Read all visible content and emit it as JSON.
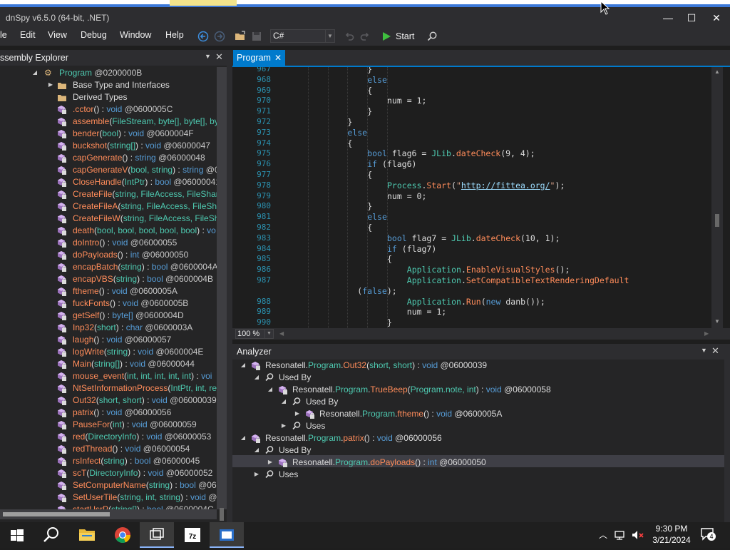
{
  "window": {
    "title": "dnSpy v6.5.0 (64-bit, .NET)",
    "minimize": "—",
    "maximize": "☐",
    "close": "✕"
  },
  "menu": [
    "le",
    "Edit",
    "View",
    "Debug",
    "Window",
    "Help"
  ],
  "toolbar": {
    "language": "C#",
    "start_label": "Start"
  },
  "assembly_explorer": {
    "title": "ssembly Explorer",
    "root": {
      "name": "Program",
      "token": "@0200000B"
    },
    "folders": [
      "Base Type and Interfaces",
      "Derived Types"
    ],
    "methods": [
      {
        "name": ".cctor",
        "args": "",
        "ret": "void",
        "token": "@0600005C"
      },
      {
        "name": "assemble",
        "args": "FileStream, byte[], byte[], by",
        "ret": "",
        "token": ""
      },
      {
        "name": "bender",
        "args": "bool",
        "ret": "void",
        "token": "@0600004F"
      },
      {
        "name": "buckshot",
        "args": "string[]",
        "ret": "void",
        "token": "@06000047"
      },
      {
        "name": "capGenerate",
        "args": "",
        "ret": "string",
        "token": "@06000048"
      },
      {
        "name": "capGenerateV",
        "args": "bool, string",
        "ret": "string",
        "token": "@0"
      },
      {
        "name": "CloseHandle",
        "args": "IntPtr",
        "ret": "bool",
        "token": "@06000041"
      },
      {
        "name": "CreateFile",
        "args": "string, FileAccess, FileShare,",
        "ret": "",
        "token": ""
      },
      {
        "name": "CreateFileA",
        "args": "string, FileAccess, FileShar",
        "ret": "",
        "token": ""
      },
      {
        "name": "CreateFileW",
        "args": "string, FileAccess, FileSha",
        "ret": "",
        "token": ""
      },
      {
        "name": "death",
        "args": "bool, bool, bool, bool, bool",
        "ret": "vo",
        "token": ""
      },
      {
        "name": "doIntro",
        "args": "",
        "ret": "void",
        "token": "@06000055"
      },
      {
        "name": "doPayloads",
        "args": "",
        "ret": "int",
        "token": "@06000050"
      },
      {
        "name": "encapBatch",
        "args": "string",
        "ret": "bool",
        "token": "@0600004A"
      },
      {
        "name": "encapVBS",
        "args": "string",
        "ret": "bool",
        "token": "@0600004B"
      },
      {
        "name": "ftheme",
        "args": "",
        "ret": "void",
        "token": "@0600005A"
      },
      {
        "name": "fuckFonts",
        "args": "",
        "ret": "void",
        "token": "@0600005B"
      },
      {
        "name": "getSelf",
        "args": "",
        "ret": "byte[]",
        "token": "@0600004D"
      },
      {
        "name": "Inp32",
        "args": "short",
        "ret": "char",
        "token": "@0600003A"
      },
      {
        "name": "laugh",
        "args": "",
        "ret": "void",
        "token": "@06000057"
      },
      {
        "name": "logWrite",
        "args": "string",
        "ret": "void",
        "token": "@0600004E"
      },
      {
        "name": "Main",
        "args": "string[]",
        "ret": "void",
        "token": "@06000044"
      },
      {
        "name": "mouse_event",
        "args": "int, int, int, int, int",
        "ret": "voi",
        "token": ""
      },
      {
        "name": "NtSetInformationProcess",
        "args": "IntPtr, int, re",
        "ret": "",
        "token": ""
      },
      {
        "name": "Out32",
        "args": "short, short",
        "ret": "void",
        "token": "@06000039"
      },
      {
        "name": "patrix",
        "args": "",
        "ret": "void",
        "token": "@06000056"
      },
      {
        "name": "PauseFor",
        "args": "int",
        "ret": "void",
        "token": "@06000059"
      },
      {
        "name": "red",
        "args": "DirectoryInfo",
        "ret": "void",
        "token": "@06000053"
      },
      {
        "name": "redThread",
        "args": "",
        "ret": "void",
        "token": "@06000054"
      },
      {
        "name": "rsInfect",
        "args": "string",
        "ret": "bool",
        "token": "@06000045"
      },
      {
        "name": "scT",
        "args": "DirectoryInfo",
        "ret": "void",
        "token": "@06000052"
      },
      {
        "name": "SetComputerName",
        "args": "string",
        "ret": "bool",
        "token": "@06("
      },
      {
        "name": "SetUserTile",
        "args": "string, int, string",
        "ret": "void",
        "token": "@0"
      },
      {
        "name": "startUsrP",
        "args": "string[]",
        "ret": "bool",
        "token": "@0600004C"
      }
    ]
  },
  "tab": {
    "label": "Program",
    "close": "✕"
  },
  "editor": {
    "zoom": "100 %",
    "lines": [
      {
        "n": "967",
        "indent": 16,
        "t": "}"
      },
      {
        "n": "968",
        "indent": 16,
        "t": "else"
      },
      {
        "n": "969",
        "indent": 16,
        "t": "{"
      },
      {
        "n": "970",
        "indent": 20,
        "t": "num = 1;"
      },
      {
        "n": "971",
        "indent": 16,
        "t": "}"
      },
      {
        "n": "972",
        "indent": 12,
        "t": "}"
      },
      {
        "n": "973",
        "indent": 12,
        "t": "else"
      },
      {
        "n": "974",
        "indent": 12,
        "t": "{"
      },
      {
        "n": "975",
        "indent": 16,
        "t": "bool flag6 = JLib.dateCheck(9, 4);"
      },
      {
        "n": "976",
        "indent": 16,
        "t": "if (flag6)"
      },
      {
        "n": "977",
        "indent": 16,
        "t": "{"
      },
      {
        "n": "978",
        "indent": 20,
        "t": "Process.Start(\"http://fittea.org/\");"
      },
      {
        "n": "979",
        "indent": 20,
        "t": "num = 0;"
      },
      {
        "n": "980",
        "indent": 16,
        "t": "}"
      },
      {
        "n": "981",
        "indent": 16,
        "t": "else"
      },
      {
        "n": "982",
        "indent": 16,
        "t": "{"
      },
      {
        "n": "983",
        "indent": 20,
        "t": "bool flag7 = JLib.dateCheck(10, 1);"
      },
      {
        "n": "984",
        "indent": 20,
        "t": "if (flag7)"
      },
      {
        "n": "985",
        "indent": 20,
        "t": "{"
      },
      {
        "n": "986",
        "indent": 24,
        "t": "Application.EnableVisualStyles();"
      },
      {
        "n": "987",
        "indent": 24,
        "t": "Application.SetCompatibleTextRenderingDefault"
      },
      {
        "n": "",
        "indent": 14,
        "t": "(false);"
      },
      {
        "n": "988",
        "indent": 24,
        "t": "Application.Run(new danb());"
      },
      {
        "n": "989",
        "indent": 24,
        "t": "num = 1;"
      },
      {
        "n": "990",
        "indent": 20,
        "t": "}"
      }
    ]
  },
  "analyzer": {
    "title": "Analyzer",
    "rows": [
      {
        "ns": "Resonatell",
        "cls": "Program",
        "name": "Out32",
        "args": "short, short",
        "ret": "void",
        "token": "@06000039"
      },
      {
        "label": "Used By"
      },
      {
        "ns": "Resonatell",
        "cls": "Program",
        "name": "TrueBeep",
        "args": "Program.note, int",
        "ret": "void",
        "token": "@06000058"
      },
      {
        "label": "Used By"
      },
      {
        "ns": "Resonatell",
        "cls": "Program",
        "name": "ftheme",
        "args": "",
        "ret": "void",
        "token": "@0600005A"
      },
      {
        "label": "Uses"
      },
      {
        "ns": "Resonatell",
        "cls": "Program",
        "name": "patrix",
        "args": "",
        "ret": "void",
        "token": "@06000056"
      },
      {
        "label": "Used By"
      },
      {
        "ns": "Resonatell",
        "cls": "Program",
        "name": "doPayloads",
        "args": "",
        "ret": "int",
        "token": "@06000050"
      },
      {
        "label": "Uses"
      }
    ]
  },
  "taskbar": {
    "time": "9:30 PM",
    "date": "3/21/2024",
    "notifications": "4",
    "apps": [
      "windows-start",
      "search",
      "file-explorer",
      "chrome",
      "task-view",
      "7zip",
      "dnspy"
    ]
  },
  "colors": {
    "accent": "#007acc",
    "method": "#ff8c5a",
    "type": "#4ec9b0",
    "keyword": "#569cd6"
  }
}
